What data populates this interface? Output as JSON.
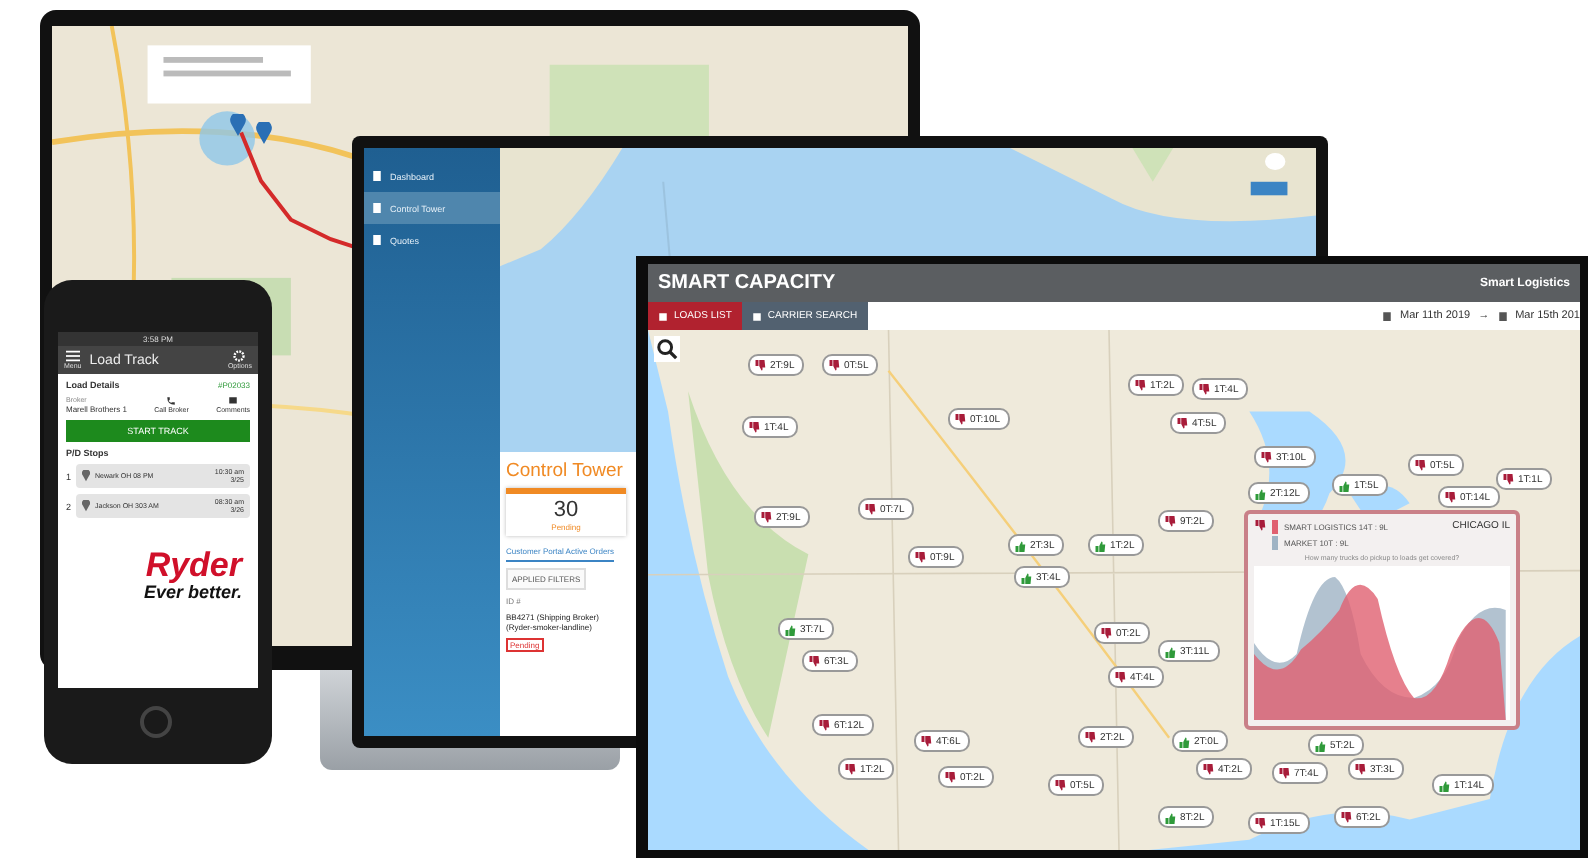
{
  "laptop": {
    "sidebar": [
      {
        "label": "Dashboard",
        "selected": false
      },
      {
        "label": "Control Tower",
        "selected": true
      },
      {
        "label": "Quotes",
        "selected": false
      }
    ],
    "page_title": "Control Tower",
    "stat_value": "30",
    "stat_label": "Pending",
    "tab": "Customer Portal Active Orders",
    "filter_button": "APPLIED FILTERS",
    "column_header": "ID #",
    "order": "BB4271 (Shipping Broker) (Ryder-smoker-landline)",
    "status": "Pending"
  },
  "phone": {
    "time": "3:58 PM",
    "menu_label": "Menu",
    "title": "Load Track",
    "options_label": "Options",
    "details_title": "Load Details",
    "load_id": "#P02033",
    "broker_caption": "Broker",
    "broker": "Marell Brothers 1",
    "call_label": "Call Broker",
    "comments_label": "Comments",
    "start_button": "START TRACK",
    "stops_title": "P/D Stops",
    "stops": [
      {
        "number": "1",
        "place": "Newark OH 08 PM",
        "time": "10:30 am",
        "date": "3/25"
      },
      {
        "number": "2",
        "place": "Jackson OH 303 AM",
        "time": "08:30 am",
        "date": "3/26"
      }
    ],
    "logo_name": "Ryder",
    "logo_tagline": "Ever better."
  },
  "front": {
    "title": "SMART CAPACITY",
    "brand": "Smart Logistics",
    "tabs": [
      {
        "label": "LOADS LIST",
        "selected": true
      },
      {
        "label": "CARRIER SEARCH",
        "selected": false
      }
    ],
    "date_from": "Mar 11th 2019",
    "arrow": "→",
    "date_to": "Mar 15th 201",
    "pins": [
      {
        "kind": "down",
        "label": "2T:9L"
      },
      {
        "kind": "down",
        "label": "0T:5L"
      },
      {
        "kind": "down",
        "label": "1T:4L"
      },
      {
        "kind": "down",
        "label": "0T:10L"
      },
      {
        "kind": "down",
        "label": "1T:2L"
      },
      {
        "kind": "down",
        "label": "1T:4L"
      },
      {
        "kind": "down",
        "label": "4T:5L"
      },
      {
        "kind": "down",
        "label": "3T:10L"
      },
      {
        "kind": "up",
        "label": "2T:12L"
      },
      {
        "kind": "up",
        "label": "1T:5L"
      },
      {
        "kind": "down",
        "label": "0T:5L"
      },
      {
        "kind": "down",
        "label": "0T:14L"
      },
      {
        "kind": "down",
        "label": "1T:1L"
      },
      {
        "kind": "down",
        "label": "2T:9L"
      },
      {
        "kind": "down",
        "label": "0T:7L"
      },
      {
        "kind": "up",
        "label": "2T:3L"
      },
      {
        "kind": "up",
        "label": "1T:2L"
      },
      {
        "kind": "down",
        "label": "9T:2L"
      },
      {
        "kind": "down",
        "label": "0T:9L"
      },
      {
        "kind": "up",
        "label": "3T:4L"
      },
      {
        "kind": "up",
        "label": "3T:7L"
      },
      {
        "kind": "down",
        "label": "6T:3L"
      },
      {
        "kind": "down",
        "label": "0T:2L"
      },
      {
        "kind": "up",
        "label": "3T:11L"
      },
      {
        "kind": "down",
        "label": "4T:4L"
      },
      {
        "kind": "down",
        "label": "6T:12L"
      },
      {
        "kind": "down",
        "label": "4T:6L"
      },
      {
        "kind": "down",
        "label": "1T:2L"
      },
      {
        "kind": "down",
        "label": "0T:2L"
      },
      {
        "kind": "down",
        "label": "0T:5L"
      },
      {
        "kind": "down",
        "label": "2T:2L"
      },
      {
        "kind": "up",
        "label": "2T:0L"
      },
      {
        "kind": "down",
        "label": "4T:2L"
      },
      {
        "kind": "down",
        "label": "7T:4L"
      },
      {
        "kind": "down",
        "label": "3T:3L"
      },
      {
        "kind": "up",
        "label": "5T:2L"
      },
      {
        "kind": "up",
        "label": "1T:14L"
      },
      {
        "kind": "up",
        "label": "8T:2L"
      },
      {
        "kind": "down",
        "label": "6T:2L"
      },
      {
        "kind": "down",
        "label": "1T:15L"
      }
    ],
    "popup": {
      "series": [
        {
          "name": "SMART LOGISTICS",
          "value": "14T : 9L",
          "color": "#e06070"
        },
        {
          "name": "MARKET",
          "value": "10T : 9L",
          "color": "#9fb3c4"
        }
      ],
      "city": "CHICAGO IL",
      "caption": "How many trucks do pickup to loads get covered?"
    }
  }
}
